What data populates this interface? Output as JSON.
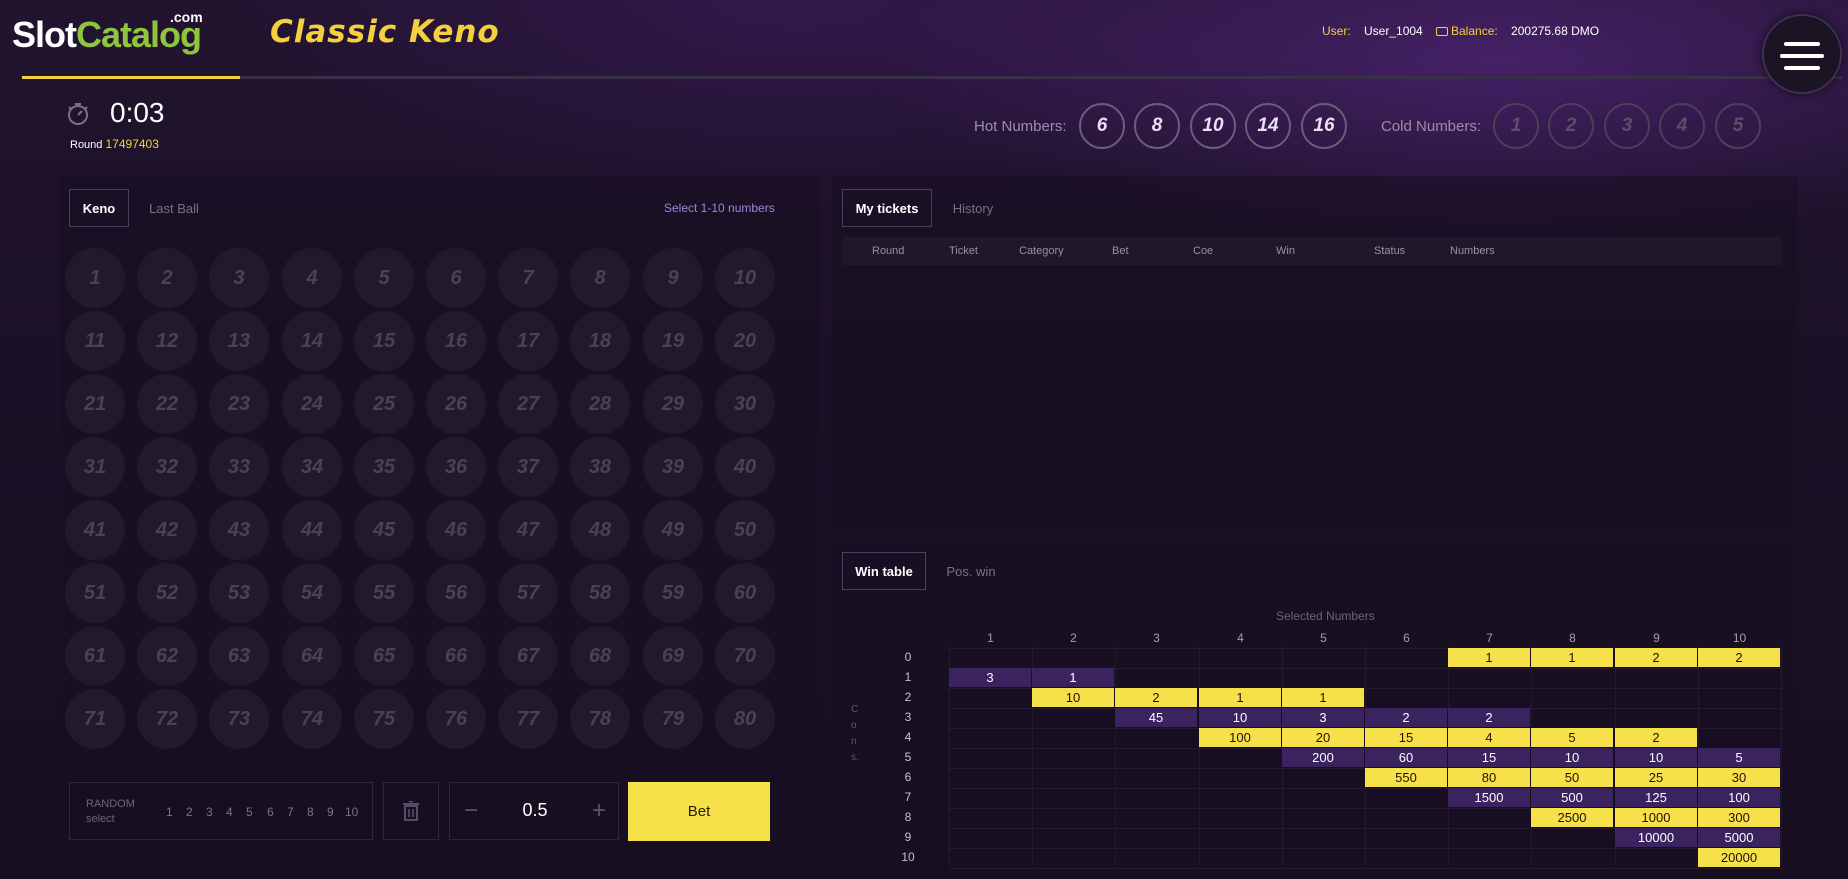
{
  "header": {
    "logo": {
      "slot": "Slot",
      "catalog": "Catalog",
      "dotcom": ".com"
    },
    "game_title": "Classic Keno",
    "round_progress": 0.12,
    "user_label": "User:",
    "user_value": "User_1004",
    "balance_label": "Balance:",
    "balance_value": "200275.68 DMO"
  },
  "timer": {
    "value": "0:03",
    "round_label": "Round",
    "round_number": "17497403"
  },
  "hot": {
    "label": "Hot Numbers:",
    "numbers": [
      "6",
      "8",
      "10",
      "14",
      "16"
    ]
  },
  "cold": {
    "label": "Cold Numbers:",
    "numbers": [
      "1",
      "2",
      "3",
      "4",
      "5"
    ]
  },
  "left_panel": {
    "tabs": [
      "Keno",
      "Last Ball"
    ],
    "hint": "Select 1-10 numbers",
    "numbers": [
      "1",
      "2",
      "3",
      "4",
      "5",
      "6",
      "7",
      "8",
      "9",
      "10",
      "11",
      "12",
      "13",
      "14",
      "15",
      "16",
      "17",
      "18",
      "19",
      "20",
      "21",
      "22",
      "23",
      "24",
      "25",
      "26",
      "27",
      "28",
      "29",
      "30",
      "31",
      "32",
      "33",
      "34",
      "35",
      "36",
      "37",
      "38",
      "39",
      "40",
      "41",
      "42",
      "43",
      "44",
      "45",
      "46",
      "47",
      "48",
      "49",
      "50",
      "51",
      "52",
      "53",
      "54",
      "55",
      "56",
      "57",
      "58",
      "59",
      "60",
      "61",
      "62",
      "63",
      "64",
      "65",
      "66",
      "67",
      "68",
      "69",
      "70",
      "71",
      "72",
      "73",
      "74",
      "75",
      "76",
      "77",
      "78",
      "79",
      "80"
    ]
  },
  "controls": {
    "random_label": "RANDOM",
    "random_sub": "select",
    "random_counts": [
      "1",
      "2",
      "3",
      "4",
      "5",
      "6",
      "7",
      "8",
      "9",
      "10"
    ],
    "stake_minus": "−",
    "stake_value": "0.5",
    "stake_plus": "+",
    "bet_label": "Bet"
  },
  "tickets": {
    "tabs": [
      "My tickets",
      "History"
    ],
    "columns": [
      "Round",
      "Ticket",
      "Category",
      "Bet",
      "Coe",
      "Win",
      "Status",
      "Numbers"
    ]
  },
  "win_table": {
    "tabs": [
      "Win table",
      "Pos. win"
    ],
    "caption": "Selected Numbers",
    "side_label": [
      "C",
      "o",
      "n",
      "s."
    ],
    "col_heads": [
      "1",
      "2",
      "3",
      "4",
      "5",
      "6",
      "7",
      "8",
      "9",
      "10"
    ],
    "row_heads": [
      "0",
      "1",
      "2",
      "3",
      "4",
      "5",
      "6",
      "7",
      "8",
      "9",
      "10"
    ],
    "cells": [
      {
        "r": 0,
        "c": 7,
        "v": "1",
        "k": "y"
      },
      {
        "r": 0,
        "c": 8,
        "v": "1",
        "k": "y"
      },
      {
        "r": 0,
        "c": 9,
        "v": "2",
        "k": "y"
      },
      {
        "r": 0,
        "c": 10,
        "v": "2",
        "k": "y"
      },
      {
        "r": 1,
        "c": 1,
        "v": "3",
        "k": "p"
      },
      {
        "r": 1,
        "c": 2,
        "v": "1",
        "k": "p"
      },
      {
        "r": 2,
        "c": 2,
        "v": "10",
        "k": "y"
      },
      {
        "r": 2,
        "c": 3,
        "v": "2",
        "k": "y"
      },
      {
        "r": 2,
        "c": 4,
        "v": "1",
        "k": "y"
      },
      {
        "r": 2,
        "c": 5,
        "v": "1",
        "k": "y"
      },
      {
        "r": 3,
        "c": 3,
        "v": "45",
        "k": "p"
      },
      {
        "r": 3,
        "c": 4,
        "v": "10",
        "k": "p"
      },
      {
        "r": 3,
        "c": 5,
        "v": "3",
        "k": "p"
      },
      {
        "r": 3,
        "c": 6,
        "v": "2",
        "k": "p"
      },
      {
        "r": 3,
        "c": 7,
        "v": "2",
        "k": "p"
      },
      {
        "r": 4,
        "c": 4,
        "v": "100",
        "k": "y"
      },
      {
        "r": 4,
        "c": 5,
        "v": "20",
        "k": "y"
      },
      {
        "r": 4,
        "c": 6,
        "v": "15",
        "k": "y"
      },
      {
        "r": 4,
        "c": 7,
        "v": "4",
        "k": "y"
      },
      {
        "r": 4,
        "c": 8,
        "v": "5",
        "k": "y"
      },
      {
        "r": 4,
        "c": 9,
        "v": "2",
        "k": "y"
      },
      {
        "r": 5,
        "c": 5,
        "v": "200",
        "k": "p"
      },
      {
        "r": 5,
        "c": 6,
        "v": "60",
        "k": "p"
      },
      {
        "r": 5,
        "c": 7,
        "v": "15",
        "k": "p"
      },
      {
        "r": 5,
        "c": 8,
        "v": "10",
        "k": "p"
      },
      {
        "r": 5,
        "c": 9,
        "v": "10",
        "k": "p"
      },
      {
        "r": 5,
        "c": 10,
        "v": "5",
        "k": "p"
      },
      {
        "r": 6,
        "c": 6,
        "v": "550",
        "k": "y"
      },
      {
        "r": 6,
        "c": 7,
        "v": "80",
        "k": "y"
      },
      {
        "r": 6,
        "c": 8,
        "v": "50",
        "k": "y"
      },
      {
        "r": 6,
        "c": 9,
        "v": "25",
        "k": "y"
      },
      {
        "r": 6,
        "c": 10,
        "v": "30",
        "k": "y"
      },
      {
        "r": 7,
        "c": 7,
        "v": "1500",
        "k": "p"
      },
      {
        "r": 7,
        "c": 8,
        "v": "500",
        "k": "p"
      },
      {
        "r": 7,
        "c": 9,
        "v": "125",
        "k": "p"
      },
      {
        "r": 7,
        "c": 10,
        "v": "100",
        "k": "p"
      },
      {
        "r": 8,
        "c": 8,
        "v": "2500",
        "k": "y"
      },
      {
        "r": 8,
        "c": 9,
        "v": "1000",
        "k": "y"
      },
      {
        "r": 8,
        "c": 10,
        "v": "300",
        "k": "y"
      },
      {
        "r": 9,
        "c": 9,
        "v": "10000",
        "k": "p"
      },
      {
        "r": 9,
        "c": 10,
        "v": "5000",
        "k": "p"
      },
      {
        "r": 10,
        "c": 10,
        "v": "20000",
        "k": "y"
      }
    ]
  },
  "colors": {
    "accent": "#f6e14b",
    "purple_cell": "#3b2360",
    "background": "#1a1024"
  }
}
